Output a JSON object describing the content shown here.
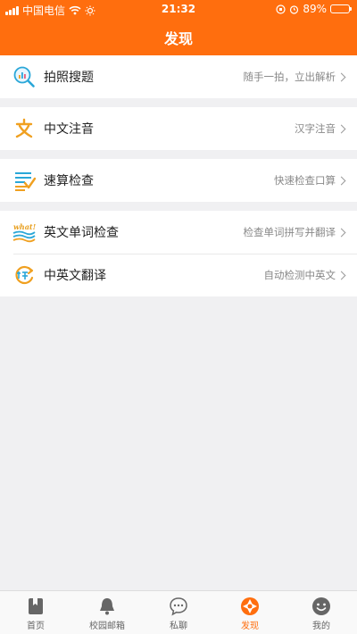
{
  "status_bar": {
    "carrier": "中国电信",
    "time": "21:32",
    "battery": "89%",
    "battery_level": 0.89
  },
  "header": {
    "title": "发现"
  },
  "groups": [
    {
      "items": [
        {
          "icon": "search-photo-icon",
          "label": "拍照搜题",
          "detail": "随手一拍，立出解析"
        }
      ]
    },
    {
      "items": [
        {
          "icon": "chinese-char-icon",
          "label": "中文注音",
          "detail": "汉字注音"
        }
      ]
    },
    {
      "items": [
        {
          "icon": "calc-check-icon",
          "label": "速算检查",
          "detail": "快速检查口算"
        }
      ]
    },
    {
      "items": [
        {
          "icon": "english-check-icon",
          "label": "英文单词检查",
          "detail": "检查单词拼写并翻译"
        },
        {
          "icon": "translate-icon",
          "label": "中英文翻译",
          "detail": "自动检测中英文"
        }
      ]
    }
  ],
  "tabbar": {
    "active": "发现",
    "tabs": [
      {
        "icon": "home-icon",
        "label": "首页"
      },
      {
        "icon": "bell-icon",
        "label": "校园邮箱"
      },
      {
        "icon": "chat-icon",
        "label": "私聊"
      },
      {
        "icon": "discover-icon",
        "label": "发现"
      },
      {
        "icon": "profile-icon",
        "label": "我的"
      }
    ]
  },
  "colors": {
    "accent": "#ff6e0e",
    "background": "#f0f0f2"
  }
}
